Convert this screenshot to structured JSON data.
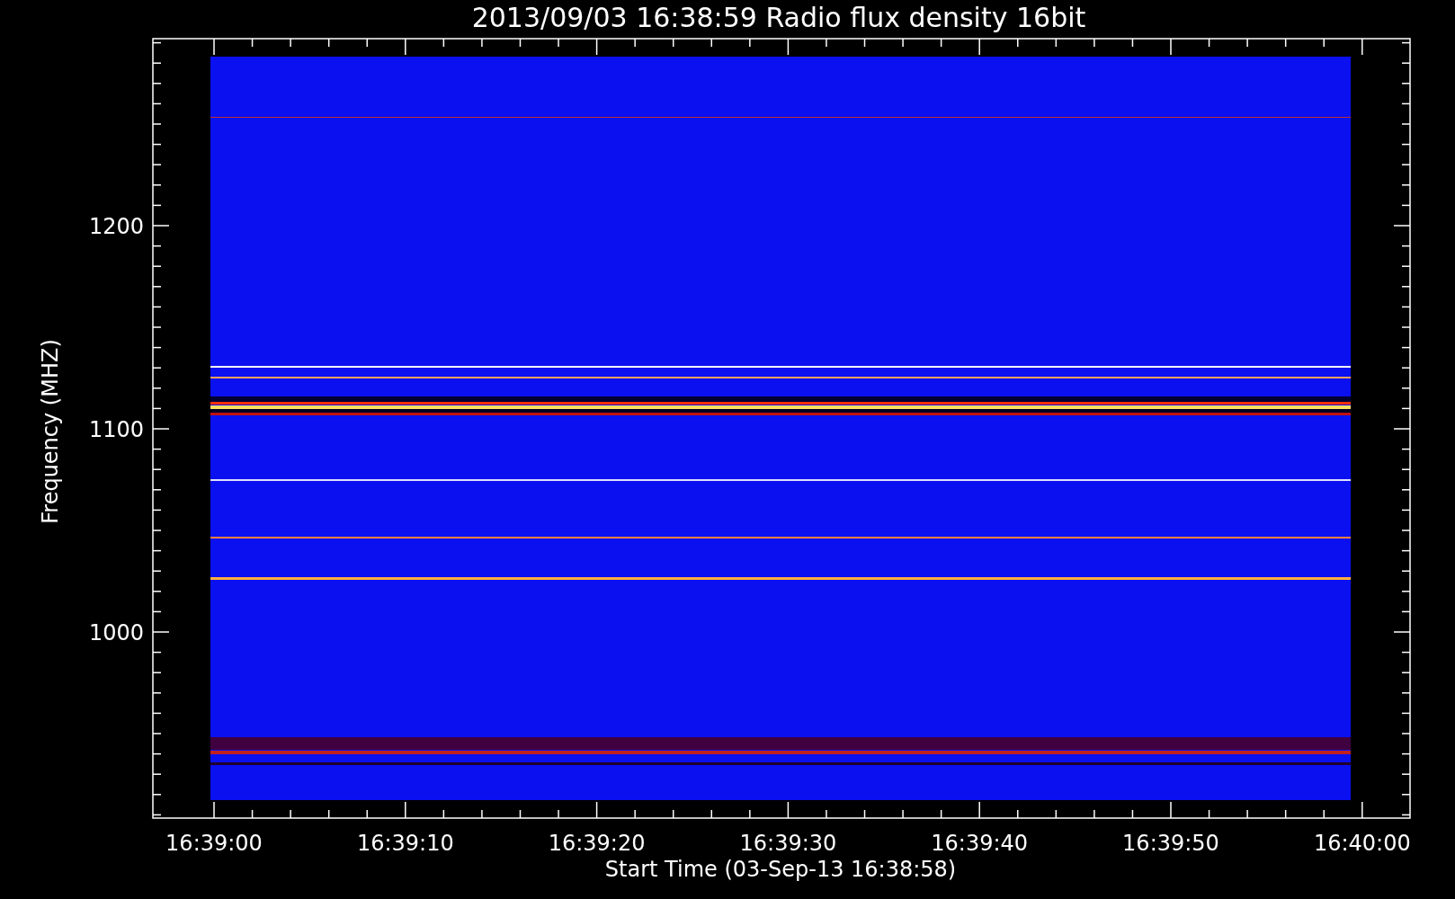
{
  "plot": {
    "title": "2013/09/03 16:38:59 Radio flux density 16bit",
    "xlabel": "Start Time (03-Sep-13 16:38:58)",
    "ylabel": "Frequency (MHZ)",
    "xticks": [
      "16:39:00",
      "16:39:10",
      "16:39:20",
      "16:39:30",
      "16:39:40",
      "16:39:50",
      "16:40:00"
    ],
    "yticks": [
      "1200",
      "1100",
      "1000"
    ]
  }
}
